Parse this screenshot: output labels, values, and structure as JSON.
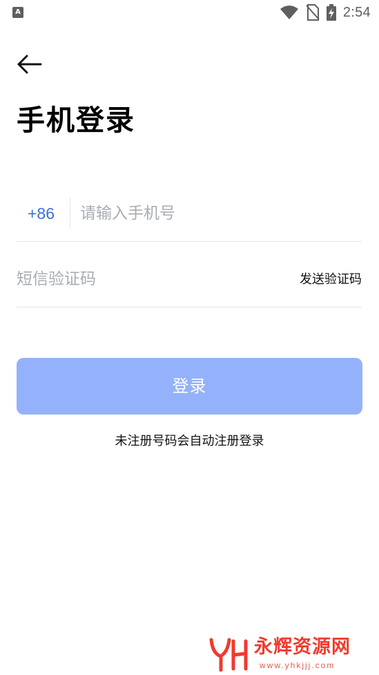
{
  "status_bar": {
    "time": "2:54",
    "left_icon": "A",
    "icons": [
      "wifi-icon",
      "no-sim-icon",
      "battery-charging-icon"
    ]
  },
  "header": {
    "back_icon": "arrow-left-icon",
    "title": "手机登录"
  },
  "form": {
    "country_code": "+86",
    "phone_placeholder": "请输入手机号",
    "code_placeholder": "短信验证码",
    "send_code_label": "发送验证码",
    "login_label": "登录",
    "register_note": "未注册号码会自动注册登录"
  },
  "watermark": {
    "logo": "YH",
    "title": "永辉资源网",
    "url": "www.yhkjjj.com"
  },
  "colors": {
    "accent": "#3b6fd6",
    "login_button_bg": "#94b2fb",
    "placeholder": "#a8acb3",
    "divider": "#e5e5e5",
    "watermark": "#ef3b2f"
  }
}
